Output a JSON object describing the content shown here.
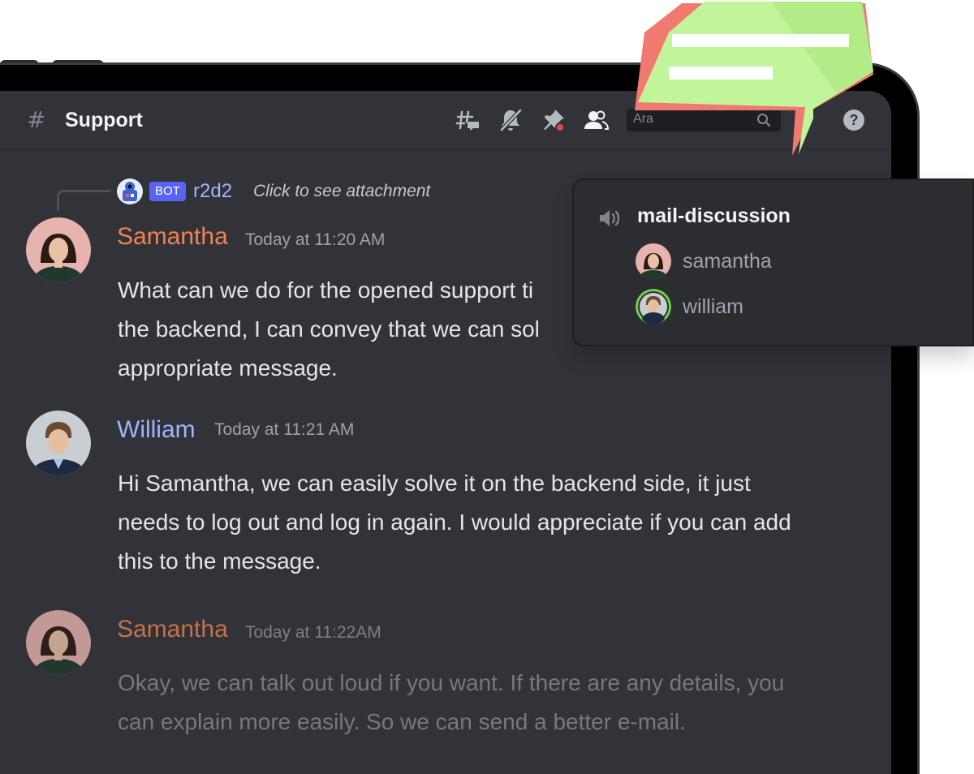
{
  "channel": {
    "name": "Support",
    "search_placeholder": "Ara"
  },
  "reply": {
    "bot_tag": "BOT",
    "username": "r2d2",
    "text": "Click to see attachment"
  },
  "messages": [
    {
      "author": "Samantha",
      "author_color": "#f0834f",
      "timestamp": "Today at 11:20 AM",
      "lines": [
        "What can we do for the opened support ti",
        "the backend, I can convey that we can sol",
        "appropriate message."
      ]
    },
    {
      "author": "William",
      "author_color": "#9bb6ff",
      "timestamp": "Today at 11:21 AM",
      "lines": [
        "Hi Samantha, we can easily solve it on the backend side, it just",
        "needs to log out and log in again. I would appreciate if you can add",
        "this to the message."
      ]
    },
    {
      "author": "Samantha",
      "author_color": "#c8714a",
      "timestamp": "Today at 11:22AM",
      "lines": [
        "Okay, we can talk out loud if you want. If there are any details, you",
        "can explain more easily. So we can send a better e-mail."
      ]
    }
  ],
  "voice_channel": {
    "name": "mail-discussion",
    "members": [
      "samantha",
      "william"
    ]
  },
  "colors": {
    "background": "#313338",
    "header_border": "#26272b",
    "popup_bg": "#2b2d31",
    "bot_tag": "#5865f2",
    "sticker_green": "#c2f59a",
    "sticker_red": "#f07a70",
    "speaking_ring": "#6fd34a"
  },
  "icons": [
    "hash-icon",
    "threads-icon",
    "mute-notifications-icon",
    "pin-icon",
    "member-list-icon",
    "search-icon",
    "help-icon",
    "speaker-icon"
  ]
}
